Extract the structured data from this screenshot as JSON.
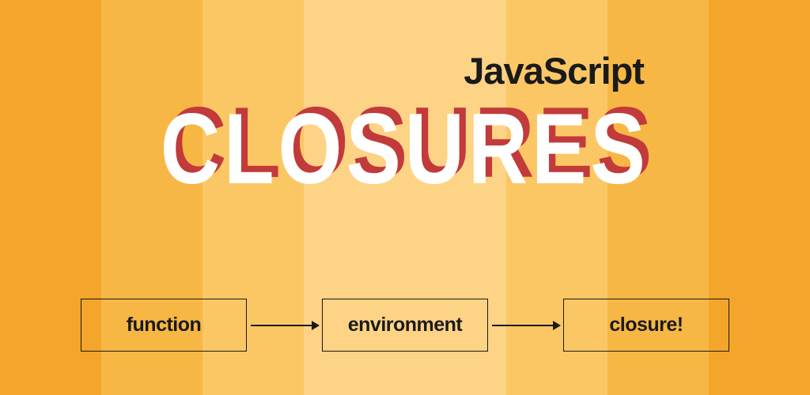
{
  "subtitle": "JavaScript",
  "title": "CLOSURES",
  "flow": {
    "box1": "function",
    "box2": "environment",
    "box3": "closure!"
  }
}
